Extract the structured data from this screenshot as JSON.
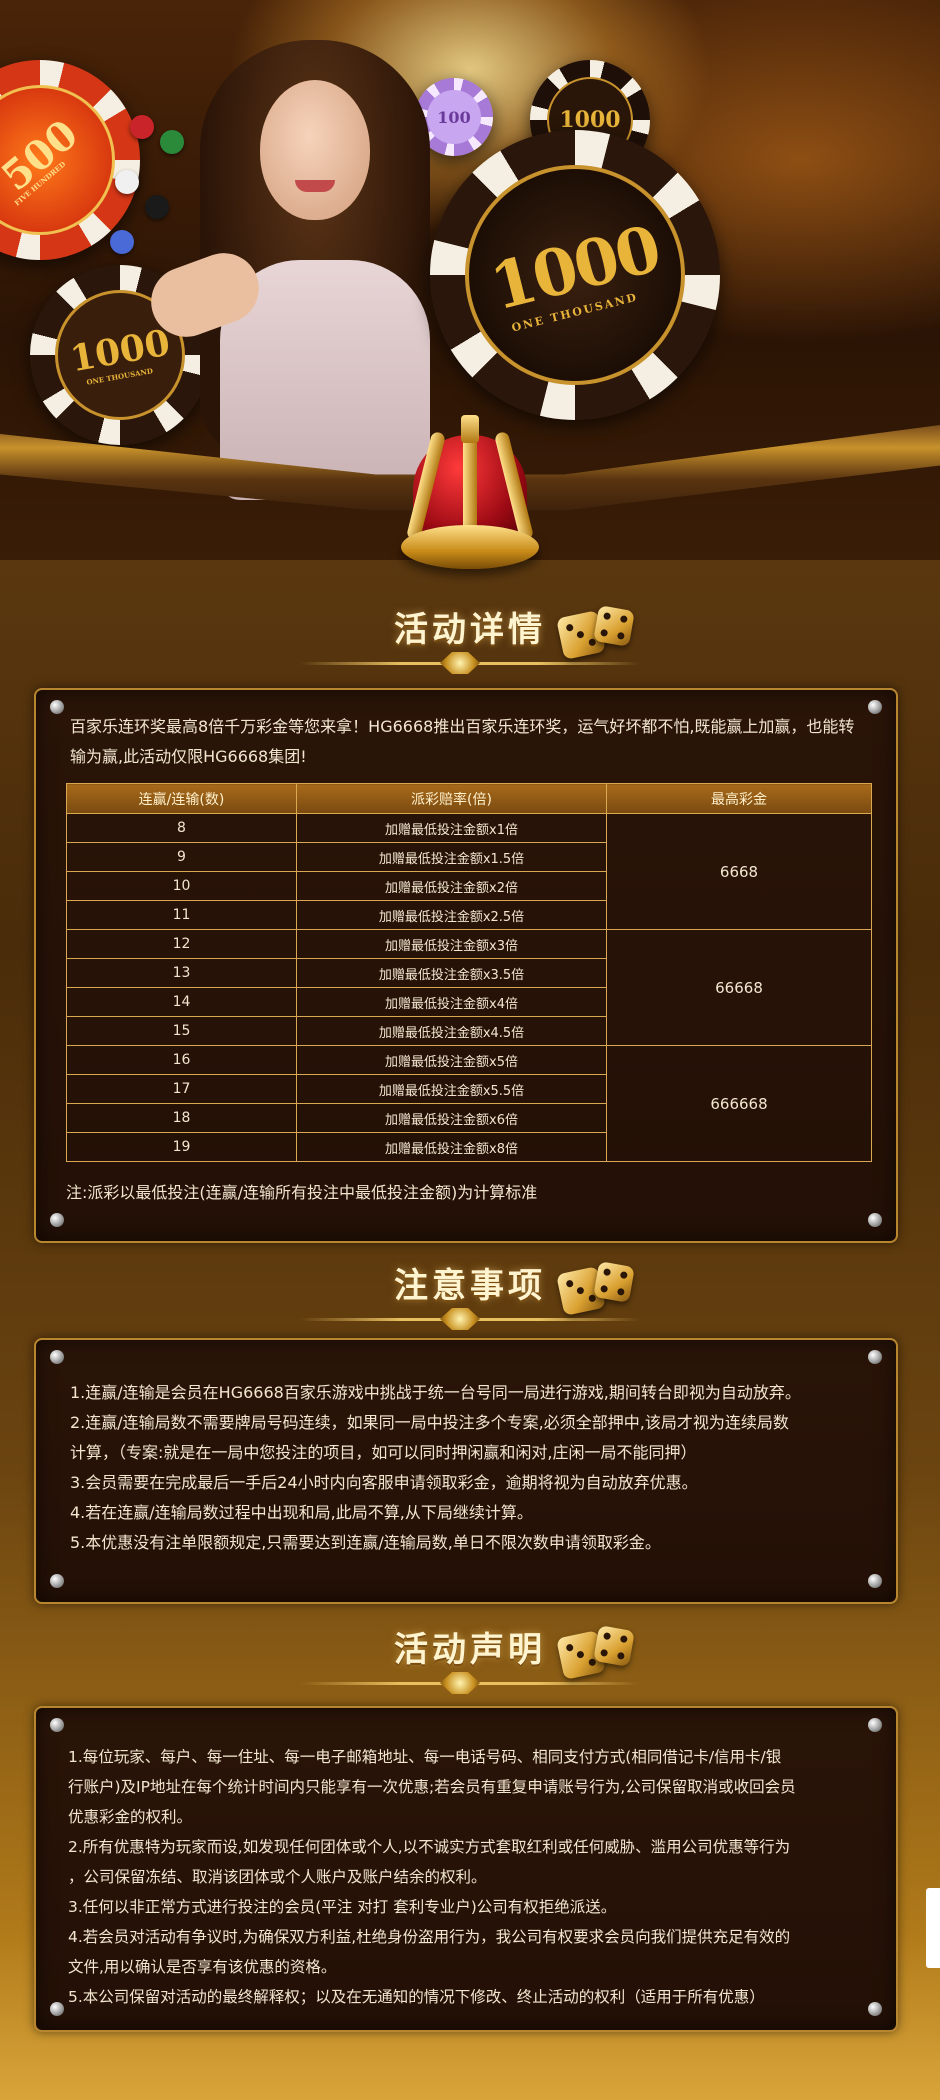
{
  "hero": {
    "chip_big_value": "1000",
    "chip_big_text": "ONE THOUSAND",
    "chip_left_value": "1000",
    "chip_left_text": "ONE THOUSAND",
    "chip_red_text": "FIVE HUNDRED",
    "chip_red_value": "500",
    "chip_top_right_value": "1000",
    "chip_purple_value": "100"
  },
  "sections": {
    "details_title": "活动详情",
    "notes_title": "注意事项",
    "statement_title": "活动声明"
  },
  "details": {
    "intro": "百家乐连环奖最高8倍千万彩金等您来拿！HG6668推出百家乐连环奖，运气好坏都不怕,既能赢上加赢，也能转输为赢,此活动仅限HG6668集团!",
    "table_headers": [
      "连赢/连输(数)",
      "派彩赔率(倍)",
      "最高彩金"
    ],
    "rows": [
      {
        "count": "8",
        "bonus": "加赠最低投注金额x1倍"
      },
      {
        "count": "9",
        "bonus": "加赠最低投注金额x1.5倍"
      },
      {
        "count": "10",
        "bonus": "加赠最低投注金额x2倍"
      },
      {
        "count": "11",
        "bonus": "加赠最低投注金额x2.5倍"
      },
      {
        "count": "12",
        "bonus": "加赠最低投注金额x3倍"
      },
      {
        "count": "13",
        "bonus": "加赠最低投注金额x3.5倍"
      },
      {
        "count": "14",
        "bonus": "加赠最低投注金额x4倍"
      },
      {
        "count": "15",
        "bonus": "加赠最低投注金额x4.5倍"
      },
      {
        "count": "16",
        "bonus": "加赠最低投注金额x5倍"
      },
      {
        "count": "17",
        "bonus": "加赠最低投注金额x5.5倍"
      },
      {
        "count": "18",
        "bonus": "加赠最低投注金额x6倍"
      },
      {
        "count": "19",
        "bonus": "加赠最低投注金额x8倍"
      }
    ],
    "max_groups": [
      "6668",
      "66668",
      "666668"
    ],
    "note": "注:派彩以最低投注(连赢/连输所有投注中最低投注金额)为计算标准"
  },
  "notes": {
    "lines": [
      "1.连赢/连输是会员在HG6668百家乐游戏中挑战于统一台号同一局进行游戏,期间转台即视为自动放弃。",
      "2.连赢/连输局数不需要牌局号码连续，如果同一局中投注多个专案,必须全部押中,该局才视为连续局数",
      "计算，（专案:就是在一局中您投注的项目，如可以同时押闲赢和闲对,庄闲一局不能同押）",
      "3.会员需要在完成最后一手后24小时内向客服申请领取彩金，逾期将视为自动放弃优惠。",
      "4.若在连赢/连输局数过程中出现和局,此局不算,从下局继续计算。",
      "5.本优惠没有注单限额规定,只需要达到连赢/连输局数,单日不限次数申请领取彩金。"
    ]
  },
  "statement": {
    "lines": [
      "1.每位玩家、每户、每一住址、每一电子邮箱地址、每一电话号码、相同支付方式(相同借记卡/信用卡/银",
      "行账户)及IP地址在每个统计时间内只能享有一次优惠;若会员有重复申请账号行为,公司保留取消或收回会员",
      "优惠彩金的权利。",
      "2.所有优惠特为玩家而设,如发现任何团体或个人,以不诚实方式套取红利或任何威胁、滥用公司优惠等行为",
      "，公司保留冻结、取消该团体或个人账户及账户结余的权利。",
      "3.任何以非正常方式进行投注的会员(平注 对打 套利专业户)公司有权拒绝派送。",
      "4.若会员对活动有争议时,为确保双方利益,杜绝身份盗用行为，我公司有权要求会员向我们提供充足有效的",
      "文件,用以确认是否享有该优惠的资格。",
      "5.本公司保留对活动的最终解释权；以及在无通知的情况下修改、终止活动的权利（适用于所有优惠）"
    ]
  },
  "colors": {
    "panel_border": "#b8862e",
    "table_border": "#d9a850",
    "text": "#f2e6cf",
    "title": "#fff4d0"
  }
}
